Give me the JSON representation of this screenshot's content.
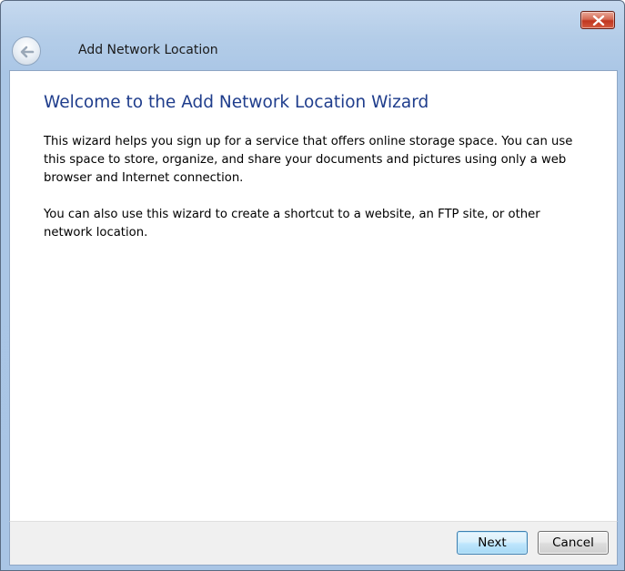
{
  "window": {
    "title": "Add Network Location"
  },
  "wizard": {
    "heading": "Welcome to the Add Network Location Wizard",
    "paragraphs": [
      "This wizard helps you sign up for a service that offers online storage space.  You can use this space to store, organize, and share your documents and pictures using only a web browser and Internet connection.",
      "You can also use this wizard to create a shortcut to a website, an FTP site, or other network location."
    ]
  },
  "buttons": {
    "next": "Next",
    "cancel": "Cancel"
  },
  "icons": {
    "back": "back-arrow-icon",
    "close": "close-icon"
  },
  "colors": {
    "heading": "#1f3d8c",
    "frame": "#aac6e6",
    "close_button": "#c0361f"
  }
}
